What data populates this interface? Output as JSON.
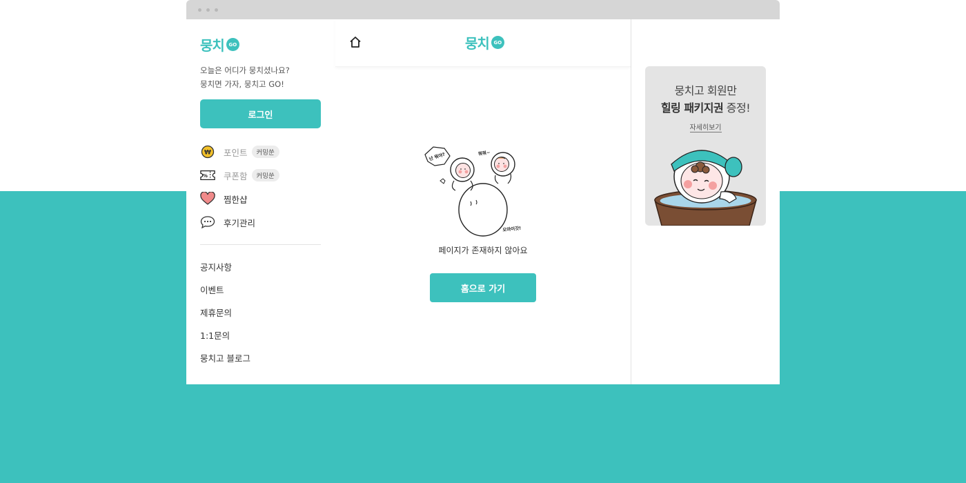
{
  "brand": {
    "name": "뭉치",
    "badge": "GO"
  },
  "sidebar": {
    "tagline1": "오늘은 어디가 뭉치셨나요?",
    "tagline2": "뭉치면 가자, 뭉치고 GO!",
    "login_label": "로그인",
    "menu": [
      {
        "label": "포인트",
        "chip": "커밍쑨",
        "icon": "coin-icon"
      },
      {
        "label": "쿠폰함",
        "chip": "커밍쑨",
        "icon": "coupon-icon"
      },
      {
        "label": "찜한샵",
        "icon": "heart-icon"
      },
      {
        "label": "후기관리",
        "icon": "speech-bubble-icon"
      }
    ],
    "links": [
      "공지사항",
      "이벤트",
      "제휴문의",
      "1:1문의",
      "뭉치고 블로그"
    ]
  },
  "main": {
    "bubble_left": "넌 뭐야?",
    "bubble_top": "뭐뭐~",
    "bubble_bottom": "오마이갓!",
    "message": "페이지가 존재하지 않아요",
    "home_button": "홈으로 가기"
  },
  "banner": {
    "line1": "뭉치고 회원만",
    "line2_bold": "힐링 패키지권",
    "line2_rest": " 증정!",
    "more": "자세히보기"
  },
  "colors": {
    "accent": "#3dc1bd",
    "heart": "#f08a8a",
    "coin": "#f3c12a"
  }
}
